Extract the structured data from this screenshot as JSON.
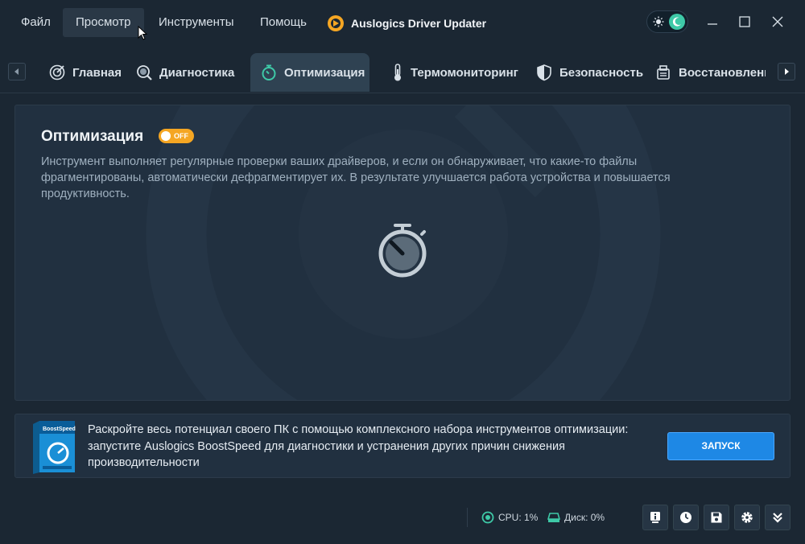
{
  "menu": {
    "file": "Файл",
    "view": "Просмотр",
    "tools": "Инструменты",
    "help": "Помощь"
  },
  "app": {
    "title": "Auslogics Driver Updater"
  },
  "tabs": [
    {
      "label": "Главная",
      "icon": "target-icon"
    },
    {
      "label": "Диагностика",
      "icon": "magnifier-icon"
    },
    {
      "label": "Оптимизация",
      "icon": "stopwatch-icon",
      "active": true
    },
    {
      "label": "Термомониторинг",
      "icon": "thermometer-icon"
    },
    {
      "label": "Безопасность",
      "icon": "shield-icon"
    },
    {
      "label": "Восстановление",
      "icon": "restore-icon"
    }
  ],
  "panel": {
    "title": "Оптимизация",
    "toggle": "OFF",
    "description": "Инструмент выполняет регулярные проверки ваших драйверов, и если он обнаруживает, что какие-то файлы фрагментированы, автоматически дефрагментирует их. В результате улучшается работа устройства и повышается продуктивность."
  },
  "promo": {
    "box_name": "BoostSpeed",
    "text": "Раскройте весь потенциал своего ПК с помощью комплексного набора инструментов оптимизации: запустите Auslogics BoostSpeed для диагностики и устранения других причин снижения производительности",
    "button": "ЗАПУСК"
  },
  "status": {
    "cpu": "CPU:  1%",
    "disk": "Диск:  0%"
  },
  "colors": {
    "background": "#1b2733",
    "panel": "#213040",
    "accent_blue": "#1e88e5",
    "toggle_orange": "#f5a623",
    "active_tab": "#2f4252",
    "teal_icon": "#3ec9a7"
  }
}
